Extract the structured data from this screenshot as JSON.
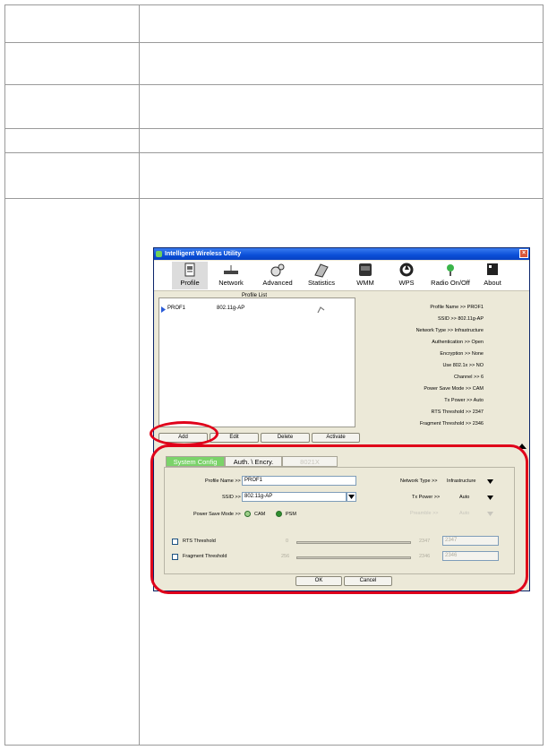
{
  "window": {
    "title": "Intelligent Wireless Utility",
    "close_glyph": "×"
  },
  "toolbar": [
    {
      "label": "Profile",
      "icon": "profile-icon"
    },
    {
      "label": "Network",
      "icon": "network-icon"
    },
    {
      "label": "Advanced",
      "icon": "advanced-icon"
    },
    {
      "label": "Statistics",
      "icon": "statistics-icon"
    },
    {
      "label": "WMM",
      "icon": "wmm-icon"
    },
    {
      "label": "WPS",
      "icon": "wps-icon"
    },
    {
      "label": "Radio On/Off",
      "icon": "radio-icon"
    },
    {
      "label": "About",
      "icon": "about-icon"
    }
  ],
  "profile_list": {
    "title": "Profile List",
    "rows": [
      {
        "name": "PROF1",
        "ssid": "802.11g-AP"
      }
    ]
  },
  "profile_info": [
    {
      "label": "Profile Name >> ",
      "value": "PROF1"
    },
    {
      "label": "SSID >> ",
      "value": "802.11g-AP"
    },
    {
      "label": "Network Type >> ",
      "value": "Infrastructure"
    },
    {
      "label": "Authentication >> ",
      "value": "Open"
    },
    {
      "label": "Encryption >> ",
      "value": "None"
    },
    {
      "label": "Use 802.1x >> ",
      "value": "NO"
    },
    {
      "label": "Channel >> ",
      "value": "6"
    },
    {
      "label": "Power Save Mode >> ",
      "value": "CAM"
    },
    {
      "label": "Tx Power >> ",
      "value": "Auto"
    },
    {
      "label": "RTS Threshold >> ",
      "value": "2347"
    },
    {
      "label": "Fragment Threshold >> ",
      "value": "2346"
    }
  ],
  "list_buttons": {
    "add": "Add",
    "edit": "Edit",
    "delete": "Delete",
    "activate": "Activate"
  },
  "tabs": {
    "system": "System Config",
    "auth": "Auth. \\ Encry.",
    "ext": "8021X"
  },
  "system_config": {
    "profile_name_label": "Profile Name >>",
    "profile_name_value": "PROF1",
    "ssid_label": "SSID >>",
    "ssid_value": "802.11g-AP",
    "power_save_label": "Power Save Mode >>",
    "cam_label": "CAM",
    "psm_label": "PSM",
    "network_type_label": "Network Type >>",
    "network_type_value": "Infrastructure",
    "tx_power_label": "Tx Power >>",
    "tx_power_value": "Auto",
    "preamble_label": "Preamble >>",
    "preamble_value": "Auto",
    "rts_label": "RTS Threshold",
    "rts_min": "0",
    "rts_max": "2347",
    "rts_value": "2347",
    "frag_label": "Fragment Threshold",
    "frag_min": "256",
    "frag_max": "2346",
    "frag_value": "2346"
  },
  "dialog_buttons": {
    "ok": "OK",
    "cancel": "Cancel"
  },
  "colors": {
    "highlight_ring": "#e0001a",
    "active_tab": "#7bd36a"
  }
}
